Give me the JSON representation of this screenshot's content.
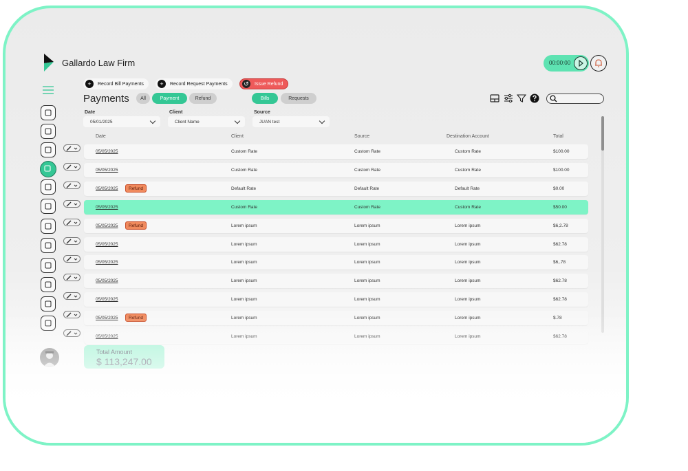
{
  "app": {
    "firm_name": "Gallardo Law Firm",
    "accent": "#34c795",
    "highlight": "#7ef3c6"
  },
  "timer": {
    "value": "00:00:00"
  },
  "sidebar": {
    "icons": [
      "dashboard-icon",
      "calendar-icon",
      "mail-icon",
      "billing-icon",
      "scales-icon",
      "contacts-icon",
      "timer-icon",
      "document-icon",
      "shield-icon",
      "payments-icon",
      "reports-icon",
      "settings-icon"
    ],
    "active": 3
  },
  "actions": {
    "record_bill": "Record Bill Payments",
    "record_request": "Record Request Payments",
    "issue_refund": "Issue Refund"
  },
  "page": {
    "title": "Payments"
  },
  "type_filter": {
    "all": "All",
    "payment": "Payment",
    "refund": "Refund",
    "selected": "Payment"
  },
  "kind_filter": {
    "bills": "Bills",
    "requests": "Requests",
    "selected": "Bills"
  },
  "filters": {
    "date": {
      "label": "Date",
      "value": "05/01/2025"
    },
    "client": {
      "label": "Client",
      "value": "Client Name"
    },
    "source": {
      "label": "Source",
      "value": "JUAN test"
    }
  },
  "table": {
    "headers": {
      "date": "Date",
      "client": "Client",
      "source": "Source",
      "destination": "Destination Account",
      "total": "Total"
    },
    "rows": [
      {
        "date": "05/05/2025",
        "refund": "",
        "client": "Custom Rate",
        "source": "Custom Rate",
        "destination": "Custom Rate",
        "total": "$100.00"
      },
      {
        "date": "05/05/2025",
        "refund": "",
        "client": "Custom Rate",
        "source": "Custom Rate",
        "destination": "Custom Rate",
        "total": "$100.00"
      },
      {
        "date": "05/05/2025",
        "refund": "Refund",
        "client": "Default Rate",
        "source": "Default Rate",
        "destination": "Default Rate",
        "total": "$0.00"
      },
      {
        "date": "05/05/2025",
        "refund": "",
        "client": "Custom Rate",
        "source": "Custom Rate",
        "destination": "Custom Rate",
        "total": "$50.00",
        "highlighted": true
      },
      {
        "date": "05/05/2025",
        "refund": "Refund",
        "client": "Lorem ipsum",
        "source": "Lorem ipsum",
        "destination": "Lorem ipsum",
        "total": "$6,2.78"
      },
      {
        "date": "05/05/2025",
        "refund": "",
        "client": "Lorem ipsum",
        "source": "Lorem ipsum",
        "destination": "Lorem ipsum",
        "total": "$62.78"
      },
      {
        "date": "05/05/2025",
        "refund": "",
        "client": "Lorem ipsum",
        "source": "Lorem ipsum",
        "destination": "Lorem ipsum",
        "total": "$6,.78"
      },
      {
        "date": "05/05/2025",
        "refund": "",
        "client": "Lorem ipsum",
        "source": "Lorem ipsum",
        "destination": "Lorem ipsum",
        "total": "$62.78"
      },
      {
        "date": "05/05/2025",
        "refund": "",
        "client": "Lorem ipsum",
        "source": "Lorem ipsum",
        "destination": "Lorem ipsum",
        "total": "$62.78"
      },
      {
        "date": "05/05/2025",
        "refund": "Refund",
        "client": "Lorem ipsum",
        "source": "Lorem ipsum",
        "destination": "Lorem ipsum",
        "total": "$.78"
      },
      {
        "date": "05/05/2025",
        "refund": "",
        "client": "Lorem ipsum",
        "source": "Lorem ipsum",
        "destination": "Lorem ipsum",
        "total": "$62.78"
      }
    ]
  },
  "summary": {
    "label": "Total Amount",
    "value": "$ 113,247.00"
  }
}
